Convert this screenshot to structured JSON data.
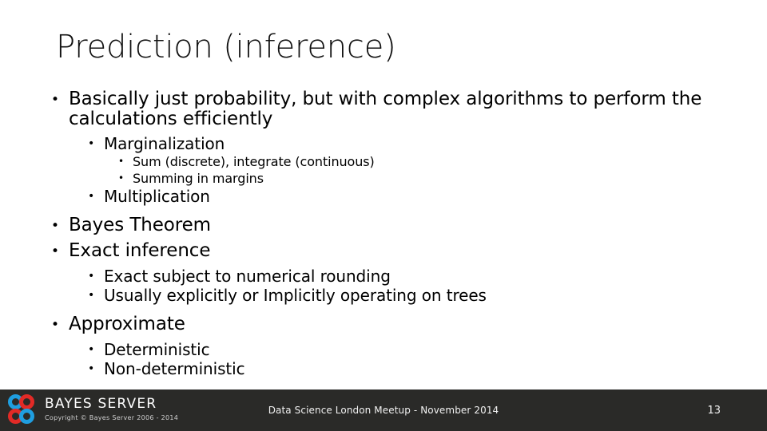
{
  "slide": {
    "title": "Prediction (inference)",
    "background_color": "#ffffff",
    "text_color": "#000000",
    "bullet_glyph": "•",
    "outline": [
      {
        "level": 1,
        "text": "Basically just probability, but with complex algorithms to perform the calculations efficiently"
      },
      {
        "level": 2,
        "text": "Marginalization"
      },
      {
        "level": 3,
        "text": "Sum (discrete), integrate (continuous)"
      },
      {
        "level": 3,
        "text": "Summing in margins"
      },
      {
        "level": 2,
        "text": "Multiplication"
      },
      {
        "level": 1,
        "text": "Bayes Theorem"
      },
      {
        "level": 1,
        "text": "Exact inference"
      },
      {
        "level": 2,
        "text": "Exact subject to numerical rounding"
      },
      {
        "level": 2,
        "text": "Usually explicitly or Implicitly operating on trees"
      },
      {
        "level": 1,
        "text": "Approximate"
      },
      {
        "level": 2,
        "text": "Deterministic"
      },
      {
        "level": 2,
        "text": "Non-deterministic"
      }
    ]
  },
  "footer": {
    "background_color": "#2a2a28",
    "brand_name": "BAYES SERVER",
    "copyright": "Copyright © Bayes Server 2006 - 2014",
    "center_text": "Data Science London Meetup - November 2014",
    "page_number": "13",
    "logo": {
      "ring_top_left_color": "#1f9ee0",
      "ring_top_right_color": "#e22a26",
      "ring_bottom_left_color": "#e22a26",
      "ring_bottom_right_color": "#1f9ee0"
    }
  }
}
